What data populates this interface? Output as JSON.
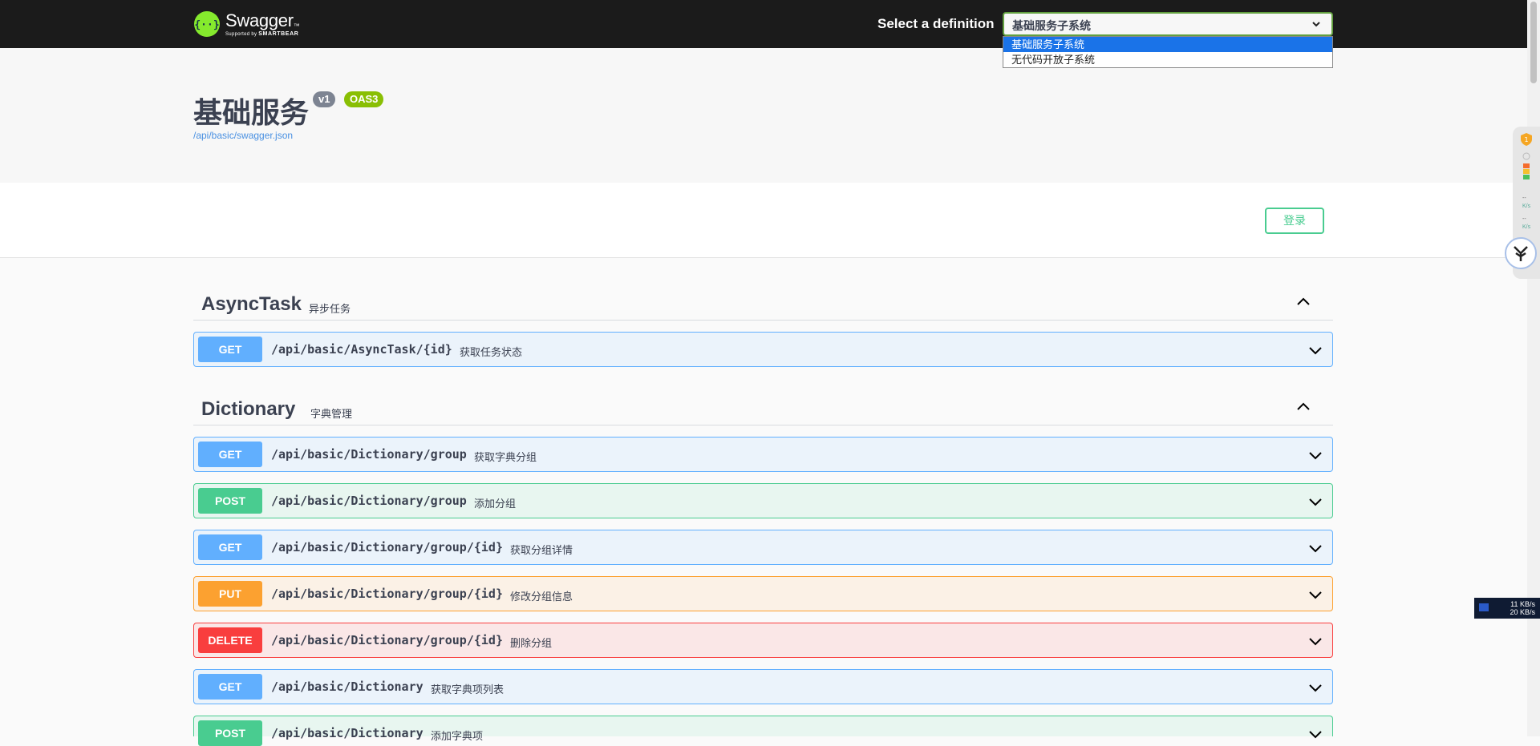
{
  "topbar": {
    "logo_name": "Swagger",
    "logo_sub": "Supported by",
    "logo_brand": "SMARTBEAR",
    "definition_label": "Select a definition",
    "definition_selected": "基础服务子系统",
    "definition_options": [
      "基础服务子系统",
      "无代码开放子系统"
    ]
  },
  "info": {
    "title": "基础服务",
    "version_badge": "v1",
    "oas_badge": "OAS3",
    "spec_url": "/api/basic/swagger.json"
  },
  "auth": {
    "login_label": "登录"
  },
  "tags": [
    {
      "name": "AsyncTask",
      "description": "异步任务",
      "operations": [
        {
          "method": "GET",
          "path": "/api/basic/AsyncTask/{id}",
          "summary": "获取任务状态"
        }
      ]
    },
    {
      "name": "Dictionary",
      "description": "字典管理",
      "operations": [
        {
          "method": "GET",
          "path": "/api/basic/Dictionary/group",
          "summary": "获取字典分组"
        },
        {
          "method": "POST",
          "path": "/api/basic/Dictionary/group",
          "summary": "添加分组"
        },
        {
          "method": "GET",
          "path": "/api/basic/Dictionary/group/{id}",
          "summary": "获取分组详情"
        },
        {
          "method": "PUT",
          "path": "/api/basic/Dictionary/group/{id}",
          "summary": "修改分组信息"
        },
        {
          "method": "DELETE",
          "path": "/api/basic/Dictionary/group/{id}",
          "summary": "删除分组"
        },
        {
          "method": "GET",
          "path": "/api/basic/Dictionary",
          "summary": "获取字典项列表"
        },
        {
          "method": "POST",
          "path": "/api/basic/Dictionary",
          "summary": "添加字典项"
        }
      ]
    }
  ],
  "widgets": {
    "net_up": "11 KB/s",
    "net_down": "20 KB/s",
    "speed_unit": "K/s",
    "speed_value": "--"
  },
  "colors": {
    "get": "#61affe",
    "post": "#49cc90",
    "put": "#fca130",
    "delete": "#f93e3e"
  }
}
